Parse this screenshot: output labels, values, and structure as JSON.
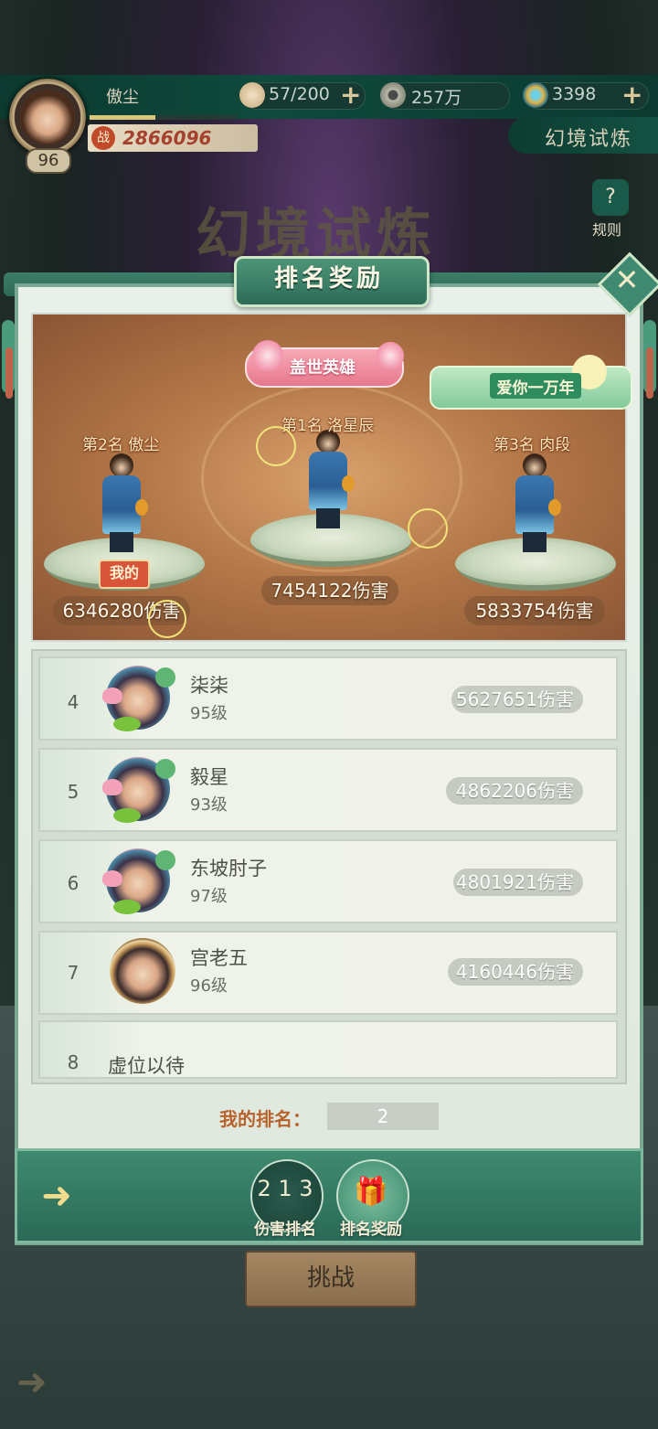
{
  "player": {
    "name": "傲尘",
    "level": "96",
    "xp_progress": 0.45,
    "power": "2866096"
  },
  "resources": [
    {
      "name": "stamina",
      "icon": "bun-icon",
      "value": "57/200"
    },
    {
      "name": "coins",
      "icon": "copper-coin-icon",
      "value": "257万"
    },
    {
      "name": "jade",
      "icon": "swirl-gem-icon",
      "value": "3398"
    }
  ],
  "header": {
    "mode_tab": "幻境试炼",
    "big_title": "幻境试炼",
    "rules_label": "规则",
    "power_icon": "战"
  },
  "modal": {
    "title": "排名奖励",
    "close_icon": "close-icon",
    "podium": [
      {
        "rank_label": "第2名",
        "name": "傲尘",
        "damage": "6346280伤害",
        "mine": true
      },
      {
        "rank_label": "第1名",
        "name": "洛星辰",
        "damage": "7454122伤害",
        "title_badge": "盖世英雄"
      },
      {
        "rank_label": "第3名",
        "name": "肉段",
        "damage": "5833754伤害",
        "title_badge": "爱你一万年"
      }
    ],
    "my_tag": "我的",
    "list": [
      {
        "rank": "4",
        "name": "柒柒",
        "level": "95级",
        "damage": "5627651伤害"
      },
      {
        "rank": "5",
        "name": "毅星",
        "level": "93级",
        "damage": "4862206伤害"
      },
      {
        "rank": "6",
        "name": "东坡肘子",
        "level": "97级",
        "damage": "4801921伤害"
      },
      {
        "rank": "7",
        "name": "宫老五",
        "level": "96级",
        "damage": "4160446伤害"
      },
      {
        "rank": "8",
        "name": "虚位以待"
      }
    ],
    "my_rank_label": "我的排名：",
    "my_rank_value": "2"
  },
  "tabs": [
    {
      "label": "伤害排名",
      "icon": "podium-icon",
      "active": true
    },
    {
      "label": "排名奖励",
      "icon": "gift-icon",
      "active": false
    }
  ],
  "challenge_button": "挑战"
}
